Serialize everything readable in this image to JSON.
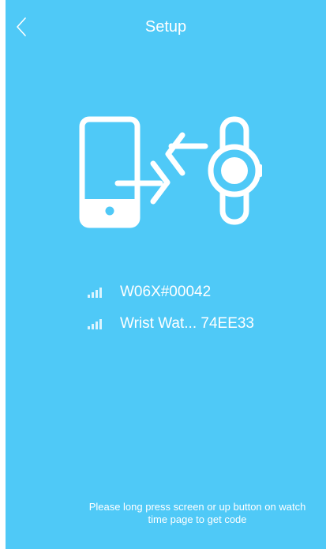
{
  "header": {
    "title": "Setup",
    "back_icon": "chevron-left-icon"
  },
  "illustration": {
    "icons": [
      "phone-icon",
      "transfer-arrows-icon",
      "watch-icon"
    ]
  },
  "devices": [
    {
      "name": "W06X#00042",
      "icon": "signal-icon"
    },
    {
      "name": "Wrist Wat... 74EE33",
      "icon": "signal-icon"
    }
  ],
  "hint": {
    "line1": "Please long press screen or up button on watch",
    "line2": "time page to get code"
  },
  "colors": {
    "background": "#4fc9f7",
    "foreground": "#ffffff"
  }
}
